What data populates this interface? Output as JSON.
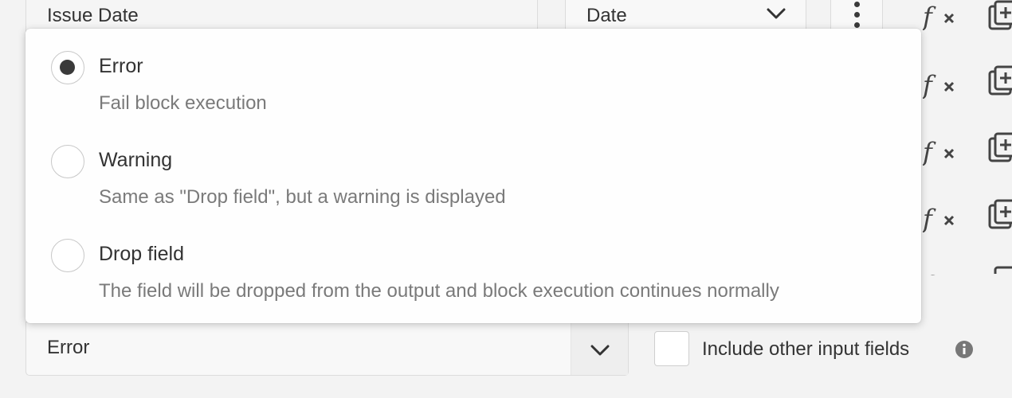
{
  "field_row": {
    "name": "Issue Date",
    "type_value": "Date"
  },
  "dropdown": {
    "options": [
      {
        "label": "Error",
        "description": "Fail block execution",
        "selected": true
      },
      {
        "label": "Warning",
        "description": "Same as \"Drop field\", but a warning is displayed",
        "selected": false
      },
      {
        "label": "Drop field",
        "description": "The field will be dropped from the output and block execution continues normally",
        "selected": false
      }
    ]
  },
  "on_error_select": {
    "value": "Error"
  },
  "include_other": {
    "label": "Include other input fields",
    "checked": false
  },
  "icons": {
    "type_chevron": "chevron-down-icon",
    "more": "kebab-menu-icon",
    "function": "fx-icon",
    "copy": "copy-add-icon",
    "info": "info-icon"
  },
  "colors": {
    "background": "#f3f3f3",
    "popup": "#fefefe",
    "text": "#333333",
    "muted_text": "#7a7a7a",
    "radio_dot": "#3a3a3a"
  }
}
